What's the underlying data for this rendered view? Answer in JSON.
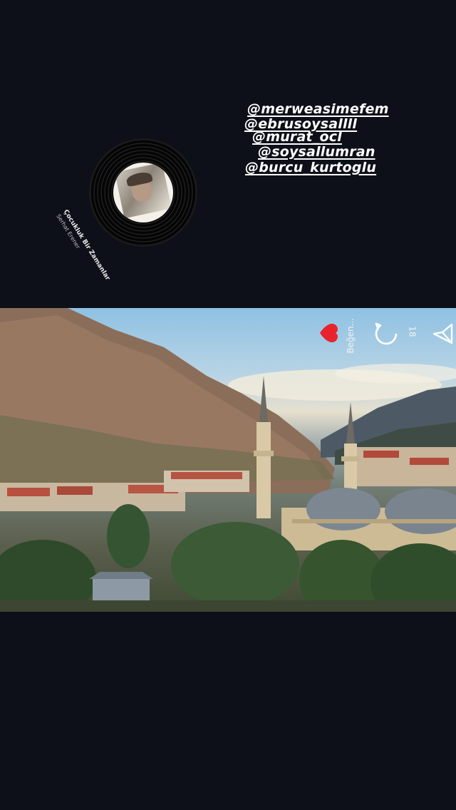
{
  "mentions": [
    "@merweasimefem",
    "@ebrusoysallll",
    "@murat_ocl",
    "@soysallumran",
    "@burcu_kurtoglu"
  ],
  "music": {
    "title": "Çocukluk Bir Zamanlar",
    "artist": "Serhat Erener"
  },
  "post": {
    "likes_label": "Beğen...",
    "comments_count": "18"
  },
  "colors": {
    "background": "#0d1019",
    "like_heart": "#e8232e"
  }
}
